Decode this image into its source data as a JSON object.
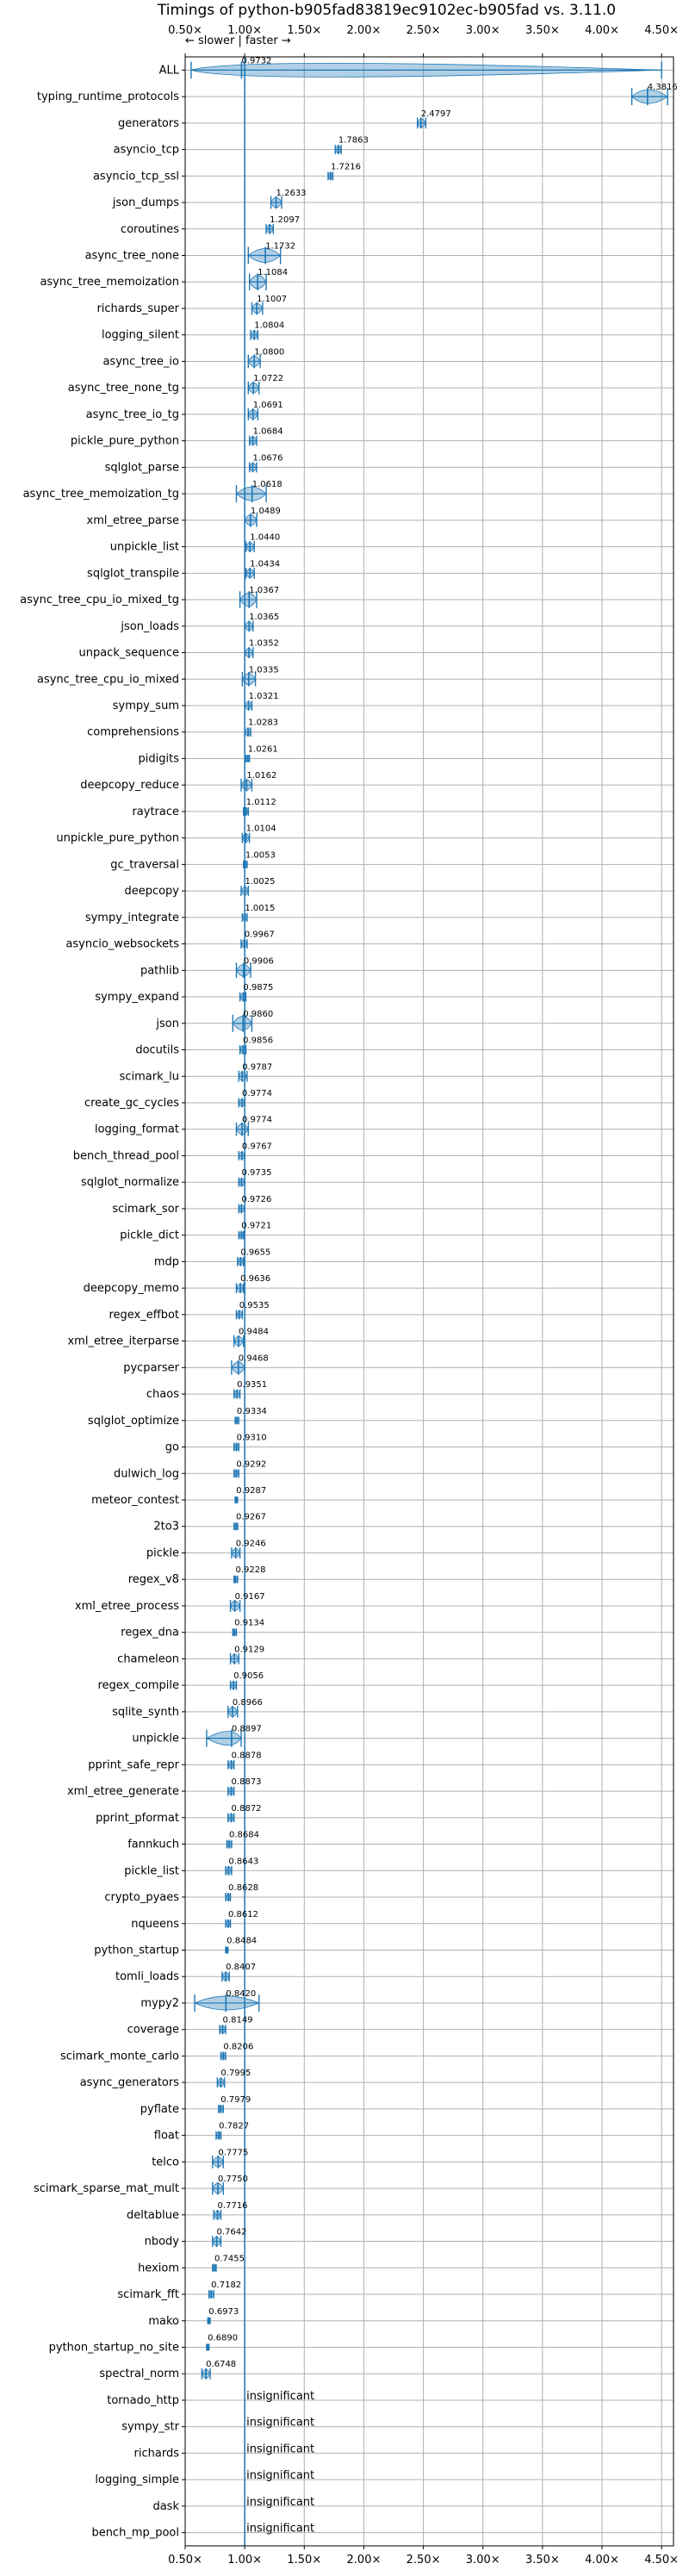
{
  "chart_data": {
    "type": "violin",
    "title": "Timings of python-b905fad83819ec9102ec-b905fad vs. 3.11.0",
    "direction_hint": "← slower | faster →",
    "xlim": [
      0.5,
      4.6
    ],
    "xticks": [
      {
        "value": 0.5,
        "label": "0.50×"
      },
      {
        "value": 1.0,
        "label": "1.00×"
      },
      {
        "value": 1.5,
        "label": "1.50×"
      },
      {
        "value": 2.0,
        "label": "2.00×"
      },
      {
        "value": 2.5,
        "label": "2.50×"
      },
      {
        "value": 3.0,
        "label": "3.00×"
      },
      {
        "value": 3.5,
        "label": "3.50×"
      },
      {
        "value": 4.0,
        "label": "4.00×"
      },
      {
        "value": 4.5,
        "label": "4.50×"
      }
    ],
    "grid": true,
    "reference_line": 1.0,
    "colors": {
      "violin": "#1f77b4",
      "axis_line": "#1f77b4",
      "grid": "#b0b0b0"
    },
    "benchmarks": [
      {
        "name": "ALL",
        "value": 0.9732,
        "label": "0.9732",
        "min": 0.55,
        "max": 4.5
      },
      {
        "name": "typing_runtime_protocols",
        "value": 4.3816,
        "label": "4.3816",
        "min": 4.25,
        "max": 4.55
      },
      {
        "name": "generators",
        "value": 2.4797,
        "label": "2.4797",
        "min": 2.45,
        "max": 2.52
      },
      {
        "name": "asyncio_tcp",
        "value": 1.7863,
        "label": "1.7863",
        "min": 1.76,
        "max": 1.81
      },
      {
        "name": "asyncio_tcp_ssl",
        "value": 1.7216,
        "label": "1.7216",
        "min": 1.7,
        "max": 1.74
      },
      {
        "name": "json_dumps",
        "value": 1.2633,
        "label": "1.2633",
        "min": 1.22,
        "max": 1.31
      },
      {
        "name": "coroutines",
        "value": 1.2097,
        "label": "1.2097",
        "min": 1.18,
        "max": 1.24
      },
      {
        "name": "async_tree_none",
        "value": 1.1732,
        "label": "1.1732",
        "min": 1.03,
        "max": 1.3
      },
      {
        "name": "async_tree_memoization",
        "value": 1.1084,
        "label": "1.1084",
        "min": 1.04,
        "max": 1.18
      },
      {
        "name": "richards_super",
        "value": 1.1007,
        "label": "1.1007",
        "min": 1.06,
        "max": 1.15
      },
      {
        "name": "logging_silent",
        "value": 1.0804,
        "label": "1.0804",
        "min": 1.05,
        "max": 1.11
      },
      {
        "name": "async_tree_io",
        "value": 1.08,
        "label": "1.0800",
        "min": 1.03,
        "max": 1.13
      },
      {
        "name": "async_tree_none_tg",
        "value": 1.0722,
        "label": "1.0722",
        "min": 1.03,
        "max": 1.12
      },
      {
        "name": "async_tree_io_tg",
        "value": 1.0691,
        "label": "1.0691",
        "min": 1.03,
        "max": 1.11
      },
      {
        "name": "pickle_pure_python",
        "value": 1.0684,
        "label": "1.0684",
        "min": 1.04,
        "max": 1.1
      },
      {
        "name": "sqlglot_parse",
        "value": 1.0676,
        "label": "1.0676",
        "min": 1.04,
        "max": 1.1
      },
      {
        "name": "async_tree_memoization_tg",
        "value": 1.0618,
        "label": "1.0618",
        "min": 0.93,
        "max": 1.18
      },
      {
        "name": "xml_etree_parse",
        "value": 1.0489,
        "label": "1.0489",
        "min": 1.0,
        "max": 1.1
      },
      {
        "name": "unpickle_list",
        "value": 1.044,
        "label": "1.0440",
        "min": 1.01,
        "max": 1.08
      },
      {
        "name": "sqlglot_transpile",
        "value": 1.0434,
        "label": "1.0434",
        "min": 1.01,
        "max": 1.08
      },
      {
        "name": "async_tree_cpu_io_mixed_tg",
        "value": 1.0367,
        "label": "1.0367",
        "min": 0.96,
        "max": 1.1
      },
      {
        "name": "json_loads",
        "value": 1.0365,
        "label": "1.0365",
        "min": 1.0,
        "max": 1.07
      },
      {
        "name": "unpack_sequence",
        "value": 1.0352,
        "label": "1.0352",
        "min": 1.0,
        "max": 1.07
      },
      {
        "name": "async_tree_cpu_io_mixed",
        "value": 1.0335,
        "label": "1.0335",
        "min": 0.98,
        "max": 1.09
      },
      {
        "name": "sympy_sum",
        "value": 1.0321,
        "label": "1.0321",
        "min": 1.0,
        "max": 1.06
      },
      {
        "name": "comprehensions",
        "value": 1.0283,
        "label": "1.0283",
        "min": 1.0,
        "max": 1.05
      },
      {
        "name": "pidigits",
        "value": 1.0261,
        "label": "1.0261",
        "min": 1.01,
        "max": 1.04
      },
      {
        "name": "deepcopy_reduce",
        "value": 1.0162,
        "label": "1.0162",
        "min": 0.97,
        "max": 1.06
      },
      {
        "name": "raytrace",
        "value": 1.0112,
        "label": "1.0112",
        "min": 0.99,
        "max": 1.03
      },
      {
        "name": "unpickle_pure_python",
        "value": 1.0104,
        "label": "1.0104",
        "min": 0.98,
        "max": 1.04
      },
      {
        "name": "gc_traversal",
        "value": 1.0053,
        "label": "1.0053",
        "min": 0.99,
        "max": 1.02
      },
      {
        "name": "deepcopy",
        "value": 1.0025,
        "label": "1.0025",
        "min": 0.97,
        "max": 1.03
      },
      {
        "name": "sympy_integrate",
        "value": 1.0015,
        "label": "1.0015",
        "min": 0.98,
        "max": 1.02
      },
      {
        "name": "asyncio_websockets",
        "value": 0.9967,
        "label": "0.9967",
        "min": 0.97,
        "max": 1.02
      },
      {
        "name": "pathlib",
        "value": 0.9906,
        "label": "0.9906",
        "min": 0.93,
        "max": 1.05
      },
      {
        "name": "sympy_expand",
        "value": 0.9875,
        "label": "0.9875",
        "min": 0.96,
        "max": 1.01
      },
      {
        "name": "json",
        "value": 0.986,
        "label": "0.9860",
        "min": 0.9,
        "max": 1.06
      },
      {
        "name": "docutils",
        "value": 0.9856,
        "label": "0.9856",
        "min": 0.96,
        "max": 1.01
      },
      {
        "name": "scimark_lu",
        "value": 0.9787,
        "label": "0.9787",
        "min": 0.95,
        "max": 1.02
      },
      {
        "name": "create_gc_cycles",
        "value": 0.9774,
        "label": "0.9774",
        "min": 0.95,
        "max": 1.0
      },
      {
        "name": "logging_format",
        "value": 0.9774,
        "label": "0.9774",
        "min": 0.93,
        "max": 1.03
      },
      {
        "name": "bench_thread_pool",
        "value": 0.9767,
        "label": "0.9767",
        "min": 0.95,
        "max": 1.0
      },
      {
        "name": "sqlglot_normalize",
        "value": 0.9735,
        "label": "0.9735",
        "min": 0.95,
        "max": 1.0
      },
      {
        "name": "scimark_sor",
        "value": 0.9726,
        "label": "0.9726",
        "min": 0.95,
        "max": 1.0
      },
      {
        "name": "pickle_dict",
        "value": 0.9721,
        "label": "0.9721",
        "min": 0.95,
        "max": 0.99
      },
      {
        "name": "mdp",
        "value": 0.9655,
        "label": "0.9655",
        "min": 0.94,
        "max": 0.99
      },
      {
        "name": "deepcopy_memo",
        "value": 0.9636,
        "label": "0.9636",
        "min": 0.93,
        "max": 0.99
      },
      {
        "name": "regex_effbot",
        "value": 0.9535,
        "label": "0.9535",
        "min": 0.93,
        "max": 0.98
      },
      {
        "name": "xml_etree_iterparse",
        "value": 0.9484,
        "label": "0.9484",
        "min": 0.91,
        "max": 0.99
      },
      {
        "name": "pycparser",
        "value": 0.9468,
        "label": "0.9468",
        "min": 0.89,
        "max": 1.0
      },
      {
        "name": "chaos",
        "value": 0.9351,
        "label": "0.9351",
        "min": 0.91,
        "max": 0.96
      },
      {
        "name": "sqlglot_optimize",
        "value": 0.9334,
        "label": "0.9334",
        "min": 0.92,
        "max": 0.95
      },
      {
        "name": "go",
        "value": 0.931,
        "label": "0.9310",
        "min": 0.91,
        "max": 0.95
      },
      {
        "name": "dulwich_log",
        "value": 0.9292,
        "label": "0.9292",
        "min": 0.91,
        "max": 0.95
      },
      {
        "name": "meteor_contest",
        "value": 0.9287,
        "label": "0.9287",
        "min": 0.92,
        "max": 0.94
      },
      {
        "name": "2to3",
        "value": 0.9267,
        "label": "0.9267",
        "min": 0.91,
        "max": 0.94
      },
      {
        "name": "pickle",
        "value": 0.9246,
        "label": "0.9246",
        "min": 0.89,
        "max": 0.96
      },
      {
        "name": "regex_v8",
        "value": 0.9228,
        "label": "0.9228",
        "min": 0.91,
        "max": 0.94
      },
      {
        "name": "xml_etree_process",
        "value": 0.9167,
        "label": "0.9167",
        "min": 0.88,
        "max": 0.96
      },
      {
        "name": "regex_dna",
        "value": 0.9134,
        "label": "0.9134",
        "min": 0.9,
        "max": 0.93
      },
      {
        "name": "chameleon",
        "value": 0.9129,
        "label": "0.9129",
        "min": 0.88,
        "max": 0.95
      },
      {
        "name": "regex_compile",
        "value": 0.9056,
        "label": "0.9056",
        "min": 0.88,
        "max": 0.93
      },
      {
        "name": "sqlite_synth",
        "value": 0.8966,
        "label": "0.8966",
        "min": 0.86,
        "max": 0.94
      },
      {
        "name": "unpickle",
        "value": 0.8897,
        "label": "0.8897",
        "min": 0.68,
        "max": 0.97
      },
      {
        "name": "pprint_safe_repr",
        "value": 0.8878,
        "label": "0.8878",
        "min": 0.86,
        "max": 0.91
      },
      {
        "name": "xml_etree_generate",
        "value": 0.8873,
        "label": "0.8873",
        "min": 0.86,
        "max": 0.91
      },
      {
        "name": "pprint_pformat",
        "value": 0.8872,
        "label": "0.8872",
        "min": 0.86,
        "max": 0.91
      },
      {
        "name": "fannkuch",
        "value": 0.8684,
        "label": "0.8684",
        "min": 0.85,
        "max": 0.89
      },
      {
        "name": "pickle_list",
        "value": 0.8643,
        "label": "0.8643",
        "min": 0.84,
        "max": 0.89
      },
      {
        "name": "crypto_pyaes",
        "value": 0.8628,
        "label": "0.8628",
        "min": 0.84,
        "max": 0.88
      },
      {
        "name": "nqueens",
        "value": 0.8612,
        "label": "0.8612",
        "min": 0.84,
        "max": 0.88
      },
      {
        "name": "python_startup",
        "value": 0.8484,
        "label": "0.8484",
        "min": 0.84,
        "max": 0.86
      },
      {
        "name": "tomli_loads",
        "value": 0.8407,
        "label": "0.8407",
        "min": 0.81,
        "max": 0.87
      },
      {
        "name": "mypy2",
        "value": 0.842,
        "label": "0.8420",
        "min": 0.58,
        "max": 1.12
      },
      {
        "name": "coverage",
        "value": 0.8149,
        "label": "0.8149",
        "min": 0.79,
        "max": 0.84
      },
      {
        "name": "scimark_monte_carlo",
        "value": 0.8206,
        "label": "0.8206",
        "min": 0.8,
        "max": 0.84
      },
      {
        "name": "async_generators",
        "value": 0.7995,
        "label": "0.7995",
        "min": 0.77,
        "max": 0.83
      },
      {
        "name": "pyflate",
        "value": 0.7979,
        "label": "0.7979",
        "min": 0.78,
        "max": 0.82
      },
      {
        "name": "float",
        "value": 0.7827,
        "label": "0.7827",
        "min": 0.76,
        "max": 0.8
      },
      {
        "name": "telco",
        "value": 0.7775,
        "label": "0.7775",
        "min": 0.73,
        "max": 0.82
      },
      {
        "name": "scimark_sparse_mat_mult",
        "value": 0.775,
        "label": "0.7750",
        "min": 0.73,
        "max": 0.82
      },
      {
        "name": "deltablue",
        "value": 0.7716,
        "label": "0.7716",
        "min": 0.74,
        "max": 0.8
      },
      {
        "name": "nbody",
        "value": 0.7642,
        "label": "0.7642",
        "min": 0.73,
        "max": 0.8
      },
      {
        "name": "hexiom",
        "value": 0.7455,
        "label": "0.7455",
        "min": 0.73,
        "max": 0.76
      },
      {
        "name": "scimark_fft",
        "value": 0.7182,
        "label": "0.7182",
        "min": 0.7,
        "max": 0.74
      },
      {
        "name": "mako",
        "value": 0.6973,
        "label": "0.6973",
        "min": 0.69,
        "max": 0.71
      },
      {
        "name": "python_startup_no_site",
        "value": 0.689,
        "label": "0.6890",
        "min": 0.68,
        "max": 0.7
      },
      {
        "name": "spectral_norm",
        "value": 0.6748,
        "label": "0.6748",
        "min": 0.64,
        "max": 0.71
      },
      {
        "name": "tornado_http",
        "value": null,
        "label": "insignificant"
      },
      {
        "name": "sympy_str",
        "value": null,
        "label": "insignificant"
      },
      {
        "name": "richards",
        "value": null,
        "label": "insignificant"
      },
      {
        "name": "logging_simple",
        "value": null,
        "label": "insignificant"
      },
      {
        "name": "dask",
        "value": null,
        "label": "insignificant"
      },
      {
        "name": "bench_mp_pool",
        "value": null,
        "label": "insignificant"
      }
    ]
  }
}
